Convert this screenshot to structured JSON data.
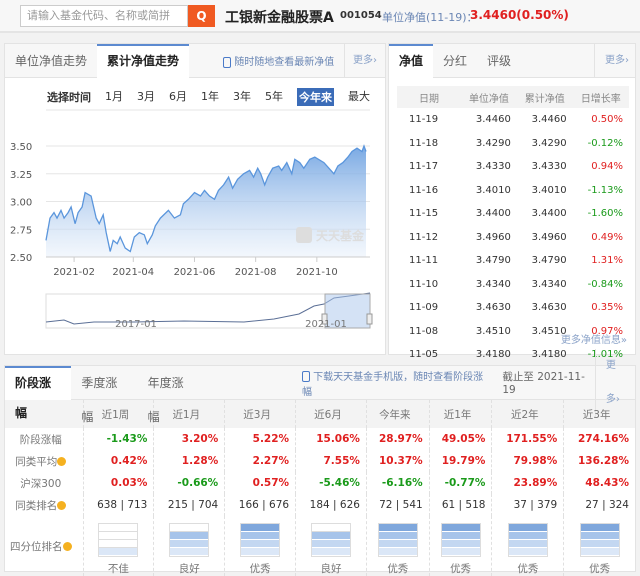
{
  "header": {
    "search_placeholder": "请输入基金代码、名称或简拼",
    "fund_name": "工银新金融股票A",
    "fund_code": "001054",
    "nav_label": "单位净值(11-19)：",
    "nav_value": "3.4460(0.50%)"
  },
  "chart_panel": {
    "tabs": [
      "单位净值走势",
      "累计净值走势"
    ],
    "active_tab": 1,
    "promo": "随时随地查看最新净值",
    "more": "更多›",
    "range_label": "选择时间",
    "ranges": [
      "1月",
      "3月",
      "6月",
      "1年",
      "3年",
      "5年",
      "今年来",
      "最大"
    ],
    "active_range": "今年来",
    "watermark": "天天基金"
  },
  "chart_data": {
    "type": "area",
    "title": "累计净值走势",
    "ylim": [
      2.5,
      3.5
    ],
    "yticks": [
      "3.50",
      "3.25",
      "3.00",
      "2.75",
      "2.50"
    ],
    "xticks": [
      "2021-02",
      "2021-04",
      "2021-06",
      "2021-08",
      "2021-10"
    ],
    "navigator_labels": [
      "2017-01",
      "2021-01"
    ],
    "points": [
      [
        "2021-01-04",
        2.65
      ],
      [
        "2021-01-08",
        2.85
      ],
      [
        "2021-01-12",
        2.9
      ],
      [
        "2021-01-15",
        2.85
      ],
      [
        "2021-01-19",
        2.92
      ],
      [
        "2021-01-22",
        2.85
      ],
      [
        "2021-01-26",
        2.9
      ],
      [
        "2021-01-29",
        2.95
      ],
      [
        "2021-02-02",
        2.8
      ],
      [
        "2021-02-05",
        2.9
      ],
      [
        "2021-02-09",
        2.95
      ],
      [
        "2021-02-12",
        3.08
      ],
      [
        "2021-02-18",
        3.05
      ],
      [
        "2021-02-23",
        2.85
      ],
      [
        "2021-02-26",
        2.8
      ],
      [
        "2021-03-02",
        2.88
      ],
      [
        "2021-03-05",
        2.72
      ],
      [
        "2021-03-09",
        2.55
      ],
      [
        "2021-03-12",
        2.65
      ],
      [
        "2021-03-16",
        2.62
      ],
      [
        "2021-03-19",
        2.68
      ],
      [
        "2021-03-24",
        2.58
      ],
      [
        "2021-03-29",
        2.55
      ],
      [
        "2021-04-02",
        2.68
      ],
      [
        "2021-04-07",
        2.72
      ],
      [
        "2021-04-12",
        2.7
      ],
      [
        "2021-04-15",
        2.62
      ],
      [
        "2021-04-20",
        2.7
      ],
      [
        "2021-04-23",
        2.78
      ],
      [
        "2021-04-28",
        2.85
      ],
      [
        "2021-05-06",
        2.92
      ],
      [
        "2021-05-12",
        2.85
      ],
      [
        "2021-05-18",
        2.88
      ],
      [
        "2021-05-21",
        2.98
      ],
      [
        "2021-05-26",
        3.02
      ],
      [
        "2021-06-01",
        3.08
      ],
      [
        "2021-06-07",
        3.05
      ],
      [
        "2021-06-11",
        3.1
      ],
      [
        "2021-06-16",
        3.05
      ],
      [
        "2021-06-21",
        3.02
      ],
      [
        "2021-06-25",
        3.1
      ],
      [
        "2021-06-30",
        3.15
      ],
      [
        "2021-07-05",
        3.22
      ],
      [
        "2021-07-09",
        3.12
      ],
      [
        "2021-07-14",
        3.2
      ],
      [
        "2021-07-20",
        3.25
      ],
      [
        "2021-07-26",
        3.28
      ],
      [
        "2021-07-30",
        3.22
      ],
      [
        "2021-08-03",
        3.3
      ],
      [
        "2021-08-06",
        3.25
      ],
      [
        "2021-08-10",
        3.15
      ],
      [
        "2021-08-13",
        3.22
      ],
      [
        "2021-08-18",
        3.3
      ],
      [
        "2021-08-24",
        3.32
      ],
      [
        "2021-08-27",
        3.28
      ],
      [
        "2021-09-01",
        3.35
      ],
      [
        "2021-09-06",
        3.25
      ],
      [
        "2021-09-09",
        3.38
      ],
      [
        "2021-09-14",
        3.35
      ],
      [
        "2021-09-18",
        3.3
      ],
      [
        "2021-09-24",
        3.38
      ],
      [
        "2021-09-29",
        3.4
      ],
      [
        "2021-10-08",
        3.35
      ],
      [
        "2021-10-13",
        3.3
      ],
      [
        "2021-10-18",
        3.25
      ],
      [
        "2021-10-22",
        3.32
      ],
      [
        "2021-10-27",
        3.35
      ],
      [
        "2021-11-01",
        3.4
      ],
      [
        "2021-11-05",
        3.45
      ],
      [
        "2021-11-10",
        3.48
      ],
      [
        "2021-11-15",
        3.45
      ],
      [
        "2021-11-17",
        3.5
      ],
      [
        "2021-11-19",
        3.45
      ]
    ]
  },
  "nav_panel": {
    "tabs": [
      "净值",
      "分红",
      "评级"
    ],
    "more": "更多›",
    "columns": [
      "日期",
      "单位净值",
      "累计净值",
      "日增长率"
    ],
    "rows": [
      [
        "11-19",
        "3.4460",
        "3.4460",
        "0.50%"
      ],
      [
        "11-18",
        "3.4290",
        "3.4290",
        "-0.12%"
      ],
      [
        "11-17",
        "3.4330",
        "3.4330",
        "0.94%"
      ],
      [
        "11-16",
        "3.4010",
        "3.4010",
        "-1.13%"
      ],
      [
        "11-15",
        "3.4400",
        "3.4400",
        "-1.60%"
      ],
      [
        "11-12",
        "3.4960",
        "3.4960",
        "0.49%"
      ],
      [
        "11-11",
        "3.4790",
        "3.4790",
        "1.31%"
      ],
      [
        "11-10",
        "3.4340",
        "3.4340",
        "-0.84%"
      ],
      [
        "11-09",
        "3.4630",
        "3.4630",
        "0.35%"
      ],
      [
        "11-08",
        "3.4510",
        "3.4510",
        "0.97%"
      ],
      [
        "11-05",
        "3.4180",
        "3.4180",
        "-1.01%"
      ]
    ],
    "more_link": "更多净值信息»"
  },
  "perf_panel": {
    "tabs": [
      "阶段涨幅",
      "季度涨幅",
      "年度涨幅"
    ],
    "promo": "下载天天基金手机版，随时查看阶段涨幅",
    "as_of_label": "截止至",
    "as_of": "2021-11-19",
    "more": "更多›",
    "periods": [
      "近1周",
      "近1月",
      "近3月",
      "近6月",
      "今年来",
      "近1年",
      "近2年",
      "近3年"
    ],
    "row_labels": [
      "阶段涨幅",
      "同类平均",
      "沪深300",
      "同类排名",
      "四分位排名"
    ],
    "returns": [
      "-1.43%",
      "3.20%",
      "5.22%",
      "15.06%",
      "28.97%",
      "49.05%",
      "171.55%",
      "274.16%"
    ],
    "category_avg": [
      "0.42%",
      "1.28%",
      "2.27%",
      "7.55%",
      "10.37%",
      "19.79%",
      "79.98%",
      "136.28%"
    ],
    "csi300": [
      "0.03%",
      "-0.66%",
      "0.57%",
      "-5.46%",
      "-6.16%",
      "-0.77%",
      "23.89%",
      "48.43%"
    ],
    "rank": [
      "638 | 713",
      "215 | 704",
      "166 | 676",
      "184 | 626",
      "72 | 541",
      "61 | 518",
      "37 | 379",
      "27 | 324"
    ],
    "quartile": [
      "不佳",
      "良好",
      "优秀",
      "良好",
      "优秀",
      "优秀",
      "优秀",
      "优秀"
    ],
    "quartile_level": [
      1,
      3,
      4,
      3,
      4,
      4,
      4,
      4
    ]
  }
}
